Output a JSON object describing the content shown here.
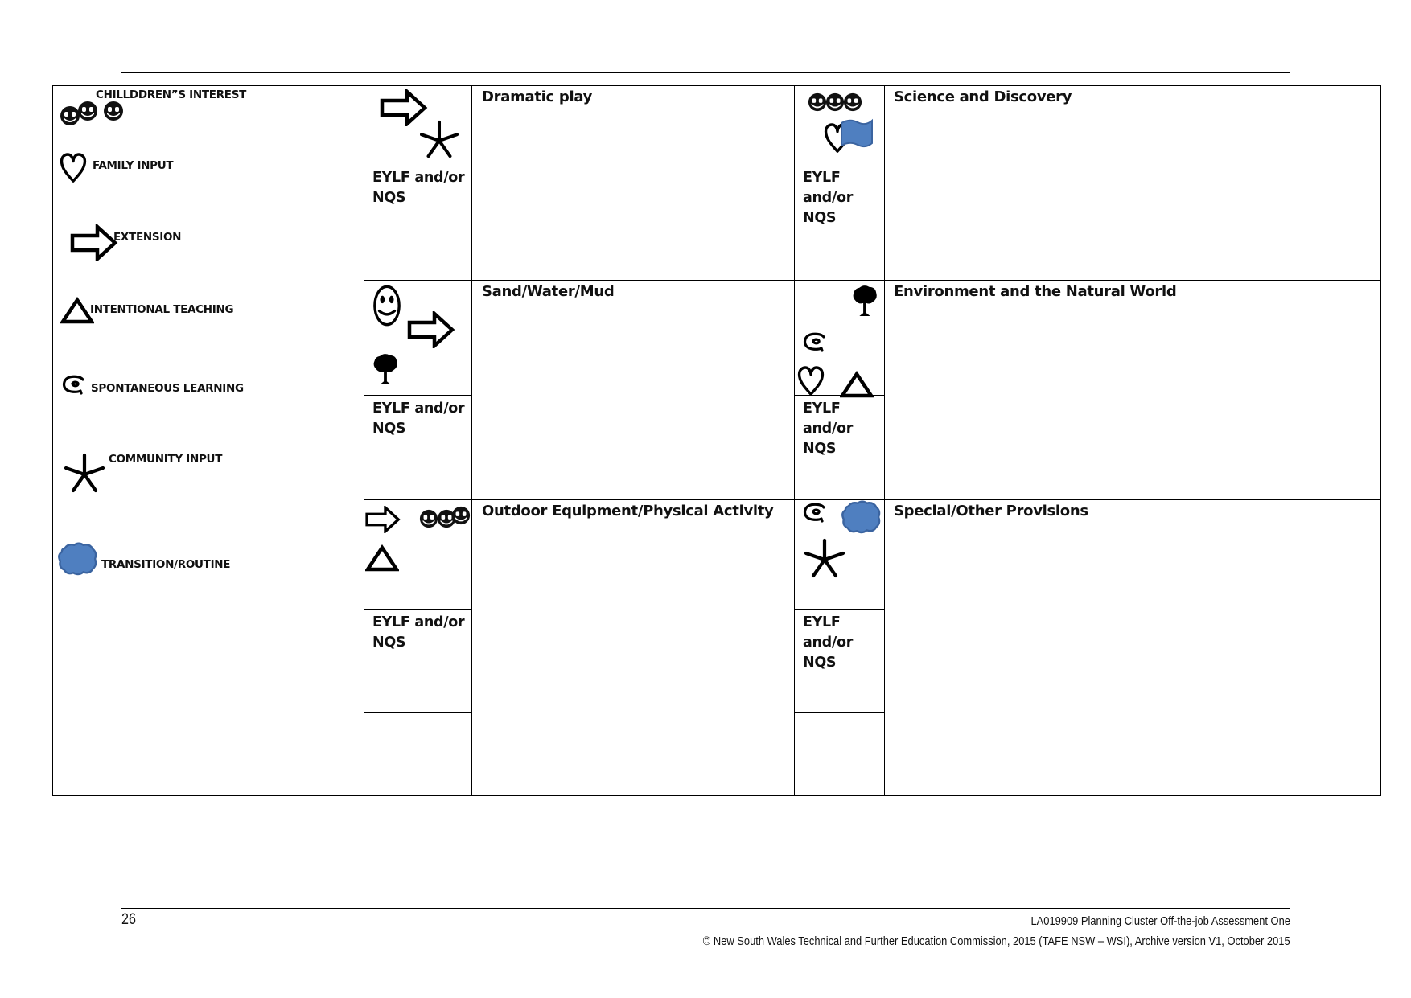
{
  "legend": {
    "items": [
      {
        "icon": "children-interest-icon",
        "label": "CHILLDDREN”S INTEREST"
      },
      {
        "icon": "family-input-icon",
        "label": "FAMILY INPUT"
      },
      {
        "icon": "extension-icon",
        "label": "EXTENSION"
      },
      {
        "icon": "intentional-teaching-icon",
        "label": "INTENTIONAL  TEACHING"
      },
      {
        "icon": "spontaneous-learning-icon",
        "label": "SPONTANEOUS LEARNING"
      },
      {
        "icon": "community-input-icon",
        "label": "COMMUNITY INPUT"
      },
      {
        "icon": "transition-routine-icon",
        "label": "TRANSITION/ROUTINE"
      }
    ]
  },
  "eylf_label": "EYLF and/or NQS",
  "areas": [
    {
      "title": "Dramatic play",
      "icons": [
        "extension-icon",
        "community-input-icon"
      ]
    },
    {
      "title": "Science and Discovery",
      "icons": [
        "children-interest-icon",
        "family-input-icon",
        "flag-icon"
      ]
    },
    {
      "title": "Sand/Water/Mud",
      "icons": [
        "smiley-icon",
        "extension-icon",
        "tree-icon"
      ]
    },
    {
      "title": "Environment and the Natural World",
      "icons": [
        "tree-icon",
        "spontaneous-learning-icon",
        "family-input-icon",
        "intentional-teaching-icon"
      ]
    },
    {
      "title": "Outdoor Equipment/Physical Activity",
      "icons": [
        "extension-icon",
        "children-interest-icon",
        "intentional-teaching-icon"
      ]
    },
    {
      "title": "Special/Other Provisions",
      "icons": [
        "spontaneous-learning-icon",
        "transition-routine-icon",
        "community-input-icon"
      ]
    }
  ],
  "footer": {
    "page_number": "26",
    "line1": "LA019909 Planning Cluster  Off-the-job Assessment One",
    "line2": "© New South Wales Technical and Further Education Commission, 2015 (TAFE NSW – WSI), Archive version V1, October 2015"
  },
  "colors": {
    "icon_blue": "#4f7fc0",
    "icon_blue_edge": "#3b64a0",
    "line": "#000000"
  }
}
